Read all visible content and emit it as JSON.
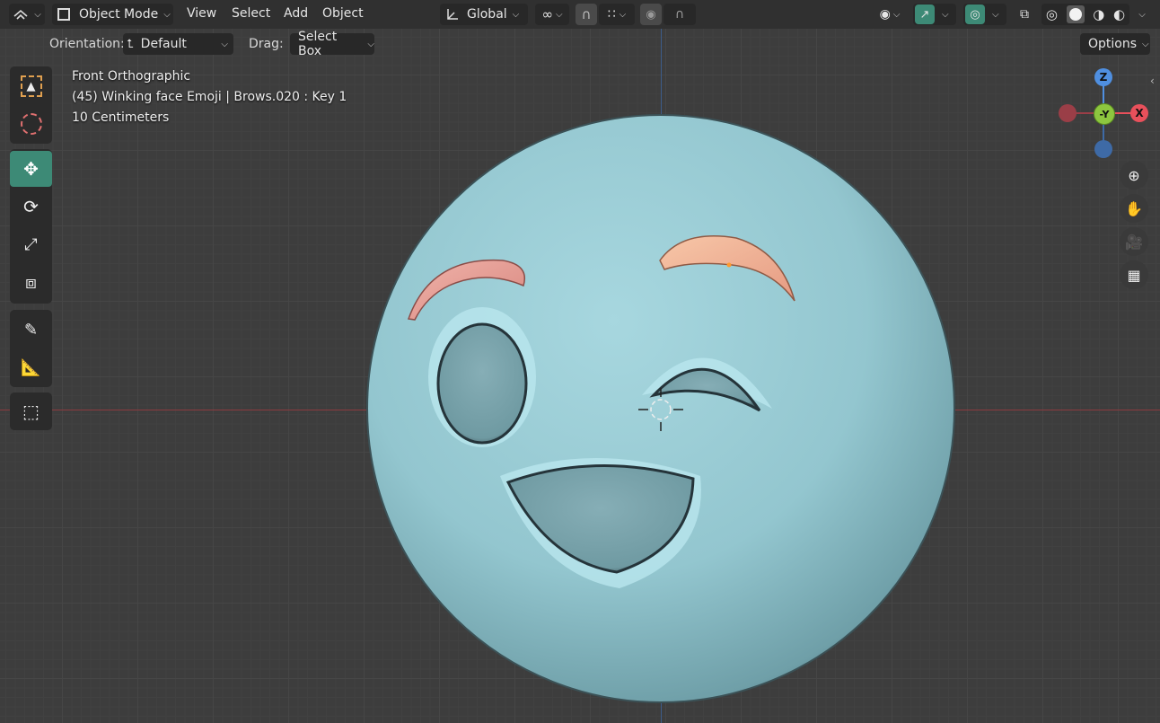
{
  "header": {
    "editor_type_icon": "editor-type-icon",
    "mode": "Object Mode",
    "menus": [
      "View",
      "Select",
      "Add",
      "Object"
    ],
    "transform_orientation": "Global",
    "colors": {
      "bar": "#303030",
      "button": "#282828",
      "active_teal": "#3d8a76"
    }
  },
  "tool_header": {
    "orientation_label": "Orientation:",
    "orientation_value": "Default",
    "drag_label": "Drag:",
    "drag_value": "Select Box",
    "options": "Options"
  },
  "overlay": {
    "view_name": "Front Orthographic",
    "object_info": "(45) Winking face Emoji | Brows.020 : Key 1",
    "scale": "10 Centimeters"
  },
  "toolbar": {
    "tools": [
      "select-box-icon",
      "cursor-icon",
      "move-icon",
      "rotate-icon",
      "scale-icon",
      "transform-icon",
      "annotate-icon",
      "measure-icon",
      "add-cube-icon"
    ],
    "active_tool": "move-icon"
  },
  "gizmo": {
    "z_label": "Z",
    "y_label": "-Y",
    "x_label": "X",
    "colors": {
      "z": "#4f8fe0",
      "y": "#8dc63f",
      "x": "#e8505b",
      "neg_x": "#9a3e47",
      "neg_z": "#3e6aa6"
    }
  },
  "navigation": [
    "zoom-icon",
    "pan-hand-icon",
    "camera-icon",
    "grid-view-icon"
  ],
  "scene": {
    "object": "winking-face-emoji",
    "colors": {
      "face": "#93c7d0",
      "brow_left": "#e8a29a",
      "brow_right": "#f1b496",
      "cavity": "#7fa4ac"
    }
  }
}
